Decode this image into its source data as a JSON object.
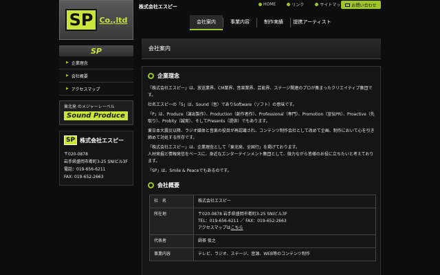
{
  "header": {
    "logo_mark": "SP",
    "logo_co": "Co.,ltd",
    "brand_title": "株式会社エスピー",
    "top_links": [
      "HOME",
      "リンク",
      "サイトマップ"
    ],
    "contact": "お問い合わせ",
    "nav": [
      "会社案内",
      "事業内容",
      "制作実績",
      "提携アーティスト"
    ]
  },
  "sidebar": {
    "head": "SP",
    "items": [
      "企業理念",
      "会社概要",
      "アクセスマップ"
    ],
    "banner_sub": "東北発 のメジャーレーベル",
    "banner_main": "Sound Produce",
    "company_mark": "SP",
    "company_name": "株式会社エスピー",
    "postal": "〒020-0878",
    "address": "岩手県盛岡市肴町3-25 SNIビル3F",
    "tel": "電話：019-656-6211",
    "fax": "FAX: 019-652-2663"
  },
  "main": {
    "page_title": "会社案内",
    "philosophy_title": "企業理念",
    "paragraphs": [
      "「株式会社エスピー」は、放送業界、CM業界、音楽業界、芸能界、ステージ関連のプロが集まったクリエイティブ集団です。",
      "社名エスピーの「S」は、Sound（音）でありSoftware（ソフト）の意味です。",
      "「P」は、Produce（演出製作）、Production（創作者作）、Professional（専門）、Promotion（宣伝PR）、Proactive（先取り）、Probity（誠実）、そしてPresents（提供）でもあります。",
      "東日本大震災以降、ラジオ媒体と音楽の役目が再認識され、コンテンツ制作会社として改めて企画、制作において心を引き締めて対処する所存です。",
      "「株式会社エスピー」は、企業理念として「東北発、全国行」を掲げております。",
      "人材発掘と情報発信をベースに、身近なエンターテインメント集団として、微力ながら皆様のお役に立ちたいと考えております。",
      "「SP」は、Smile & Peaceでもあるのです。"
    ],
    "overview_title": "会社概要",
    "table": {
      "name_label": "社　名",
      "name_value": "株式会社エスピー",
      "addr_label": "所在地",
      "addr_line1": "〒020-0878 岩手県盛岡市肴町3-25 SNIビル3F",
      "addr_line2": "TEL：019-656-6211 ／ FAX：019-652-2663",
      "addr_line3_pre": "アクセスマップは",
      "addr_line3_link": "こちら",
      "rep_label": "代表者",
      "rep_value": "師茶 俊之",
      "biz_label": "事業内容",
      "biz_value": "テレビ、ラジオ、ステージ、音源、WEB等のコンテンツ制作"
    }
  }
}
